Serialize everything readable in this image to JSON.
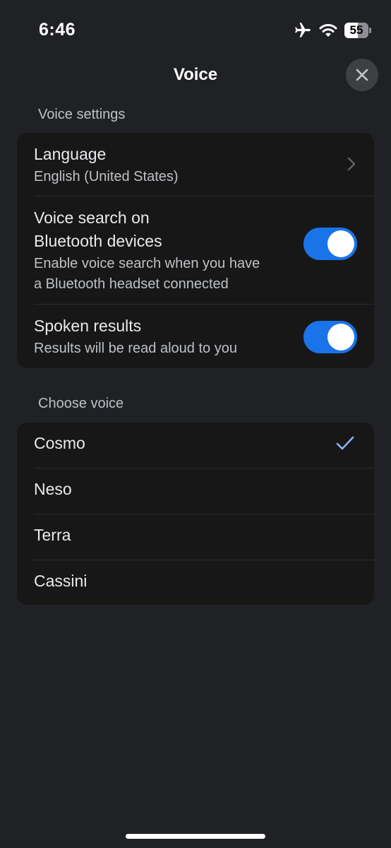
{
  "status_bar": {
    "time": "6:46",
    "battery_level": "55",
    "icons": [
      "airplane-mode-icon",
      "wifi-icon",
      "battery-icon"
    ]
  },
  "header": {
    "title": "Voice",
    "close_icon": "close-icon"
  },
  "voice_settings": {
    "section_label": "Voice settings",
    "language": {
      "title": "Language",
      "value": "English (United States)"
    },
    "bluetooth": {
      "title_line1": "Voice search on",
      "title_line2": "Bluetooth devices",
      "desc_line1": "Enable voice search when you have",
      "desc_line2": "a Bluetooth headset connected",
      "enabled": true
    },
    "spoken_results": {
      "title": "Spoken results",
      "desc": "Results will be read aloud to you",
      "enabled": true
    }
  },
  "choose_voice": {
    "section_label": "Choose voice",
    "voices": [
      "Cosmo",
      "Neso",
      "Terra",
      "Cassini"
    ],
    "selected": "Cosmo"
  },
  "colors": {
    "background": "#202124",
    "card": "#171717",
    "accent": "#1a73e8",
    "check": "#8ab4f8"
  }
}
